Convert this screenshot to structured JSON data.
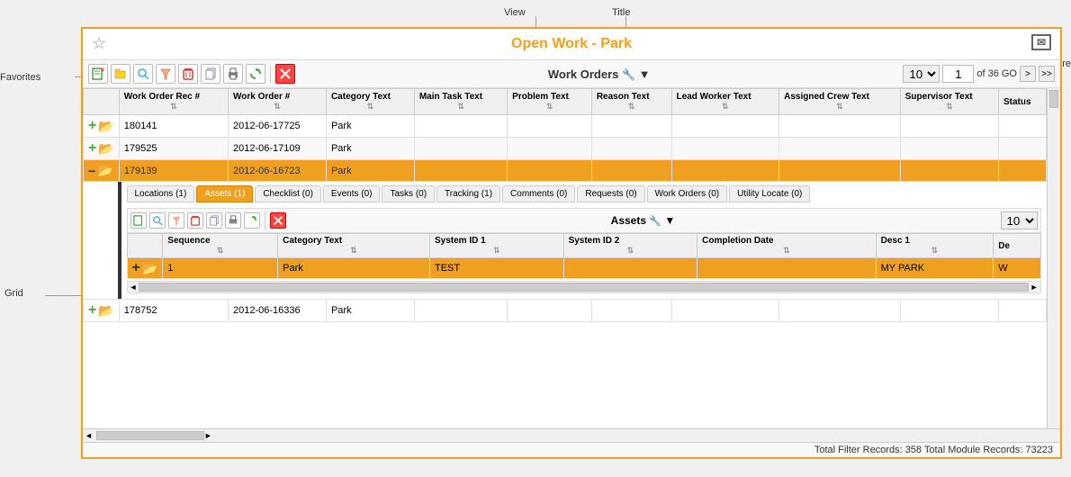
{
  "labels": {
    "view": "View",
    "title_label": "Title",
    "favorites": "Favorites",
    "grid": "Grid",
    "share": "Share"
  },
  "header": {
    "title": "Open Work - Park",
    "favorites_star": "☆"
  },
  "toolbar": {
    "title": "Work Orders",
    "page_size": "10",
    "current_page": "1",
    "total_text": "of 36 GO",
    "go_btn": ">",
    "end_btn": ">>"
  },
  "columns": [
    {
      "label": "Work Order Rec #"
    },
    {
      "label": "Work Order #"
    },
    {
      "label": "Category Text"
    },
    {
      "label": "Main Task Text"
    },
    {
      "label": "Problem Text"
    },
    {
      "label": "Reason Text"
    },
    {
      "label": "Lead Worker Text"
    },
    {
      "label": "Assigned Crew Text"
    },
    {
      "label": "Supervisor Text"
    },
    {
      "label": "Status"
    }
  ],
  "rows": [
    {
      "id": 1,
      "rec": "180141",
      "wo": "2012-06-17725",
      "cat": "Park",
      "main_task": "",
      "problem": "",
      "reason": "",
      "lead": "",
      "crew": "",
      "supervisor": "",
      "status": "",
      "type": "normal"
    },
    {
      "id": 2,
      "rec": "179525",
      "wo": "2012-06-17109",
      "cat": "Park",
      "main_task": "",
      "problem": "",
      "reason": "",
      "lead": "",
      "crew": "",
      "supervisor": "",
      "status": "",
      "type": "alt"
    },
    {
      "id": 3,
      "rec": "179139",
      "wo": "2012-06-16723",
      "cat": "Park",
      "main_task": "",
      "problem": "",
      "reason": "",
      "lead": "",
      "crew": "",
      "supervisor": "",
      "status": "",
      "type": "selected",
      "expanded": true
    },
    {
      "id": 4,
      "rec": "178752",
      "wo": "2012-06-16336",
      "cat": "Park",
      "main_task": "",
      "problem": "",
      "reason": "",
      "lead": "",
      "crew": "",
      "supervisor": "",
      "status": "",
      "type": "normal"
    }
  ],
  "subtabs": [
    {
      "label": "Locations (1)",
      "active": false
    },
    {
      "label": "Assets (1)",
      "active": true,
      "highlight": true
    },
    {
      "label": "Checklist (0)",
      "active": false
    },
    {
      "label": "Events (0)",
      "active": false
    },
    {
      "label": "Tasks (0)",
      "active": false
    },
    {
      "label": "Tracking (1)",
      "active": false
    },
    {
      "label": "Comments (0)",
      "active": false
    },
    {
      "label": "Requests (0)",
      "active": false
    },
    {
      "label": "Work Orders (0)",
      "active": false
    },
    {
      "label": "Utility Locate (0)",
      "active": false
    }
  ],
  "subgrid": {
    "title": "Assets",
    "page_size": "10",
    "columns": [
      {
        "label": "Sequence"
      },
      {
        "label": "Category Text"
      },
      {
        "label": "System ID 1"
      },
      {
        "label": "System ID 2"
      },
      {
        "label": "Completion Date"
      },
      {
        "label": "Desc 1"
      },
      {
        "label": "De"
      }
    ],
    "rows": [
      {
        "seq": "1",
        "cat": "Park",
        "sys1": "TEST",
        "sys2": "",
        "comp_date": "",
        "desc1": "MY PARK",
        "desc2": "W"
      }
    ]
  },
  "status_bar": {
    "text": "Total Filter Records: 358  Total Module Records: 73223"
  },
  "toolbar_icons": {
    "new": "📄",
    "open": "📂",
    "search": "🔍",
    "filter": "⬇",
    "delete": "🗑",
    "copy": "📋",
    "print": "🖨",
    "refresh": "🔄",
    "close": "✖"
  }
}
